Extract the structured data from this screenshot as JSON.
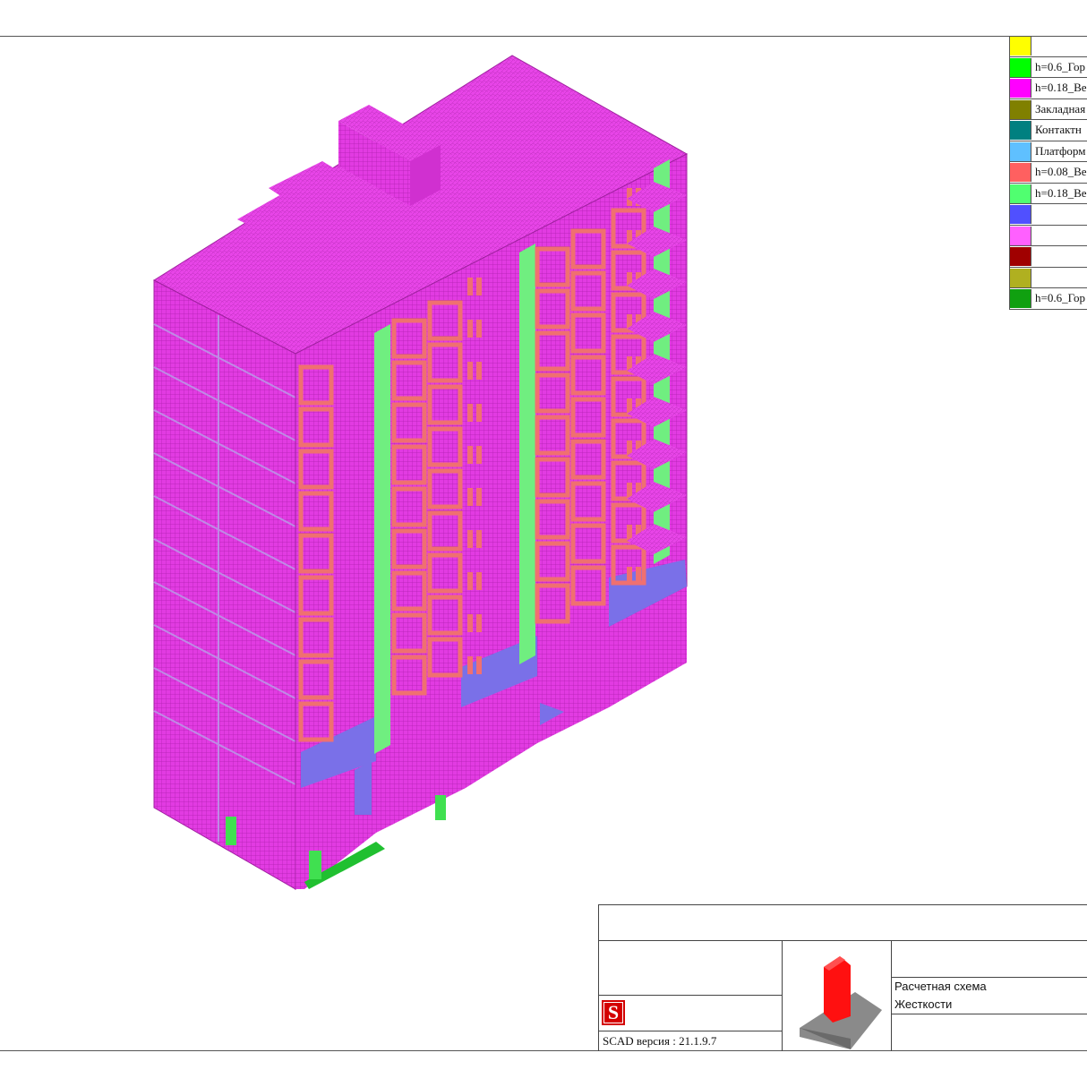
{
  "legend": [
    {
      "color": "#ffff00",
      "label": ""
    },
    {
      "color": "#00ff00",
      "label": "h=0.6_Гор"
    },
    {
      "color": "#ff00ff",
      "label": "h=0.18_Ве"
    },
    {
      "color": "#808000",
      "label": "Закладная"
    },
    {
      "color": "#008080",
      "label": "Контактн"
    },
    {
      "color": "#5fc0ff",
      "label": "Платформ"
    },
    {
      "color": "#ff6060",
      "label": "h=0.08_Ве"
    },
    {
      "color": "#50ff70",
      "label": "h=0.18_Ве"
    },
    {
      "color": "#5050ff",
      "label": ""
    },
    {
      "color": "#ff60ff",
      "label": ""
    },
    {
      "color": "#a00000",
      "label": ""
    },
    {
      "color": "#b0b020",
      "label": ""
    },
    {
      "color": "#10a010",
      "label": "h=0.6_Гор"
    }
  ],
  "stamp": {
    "scad_version": "SCAD версия : 21.1.9.7",
    "caption_line1": "Расчетная схема",
    "caption_line2": "Жесткости",
    "logo_letter": "S"
  },
  "colors": {
    "wall": "#e040e0",
    "window_frame": "#f07070",
    "balcony_green": "#66ee77",
    "blue": "#7070ee",
    "base_green": "#20c030"
  }
}
